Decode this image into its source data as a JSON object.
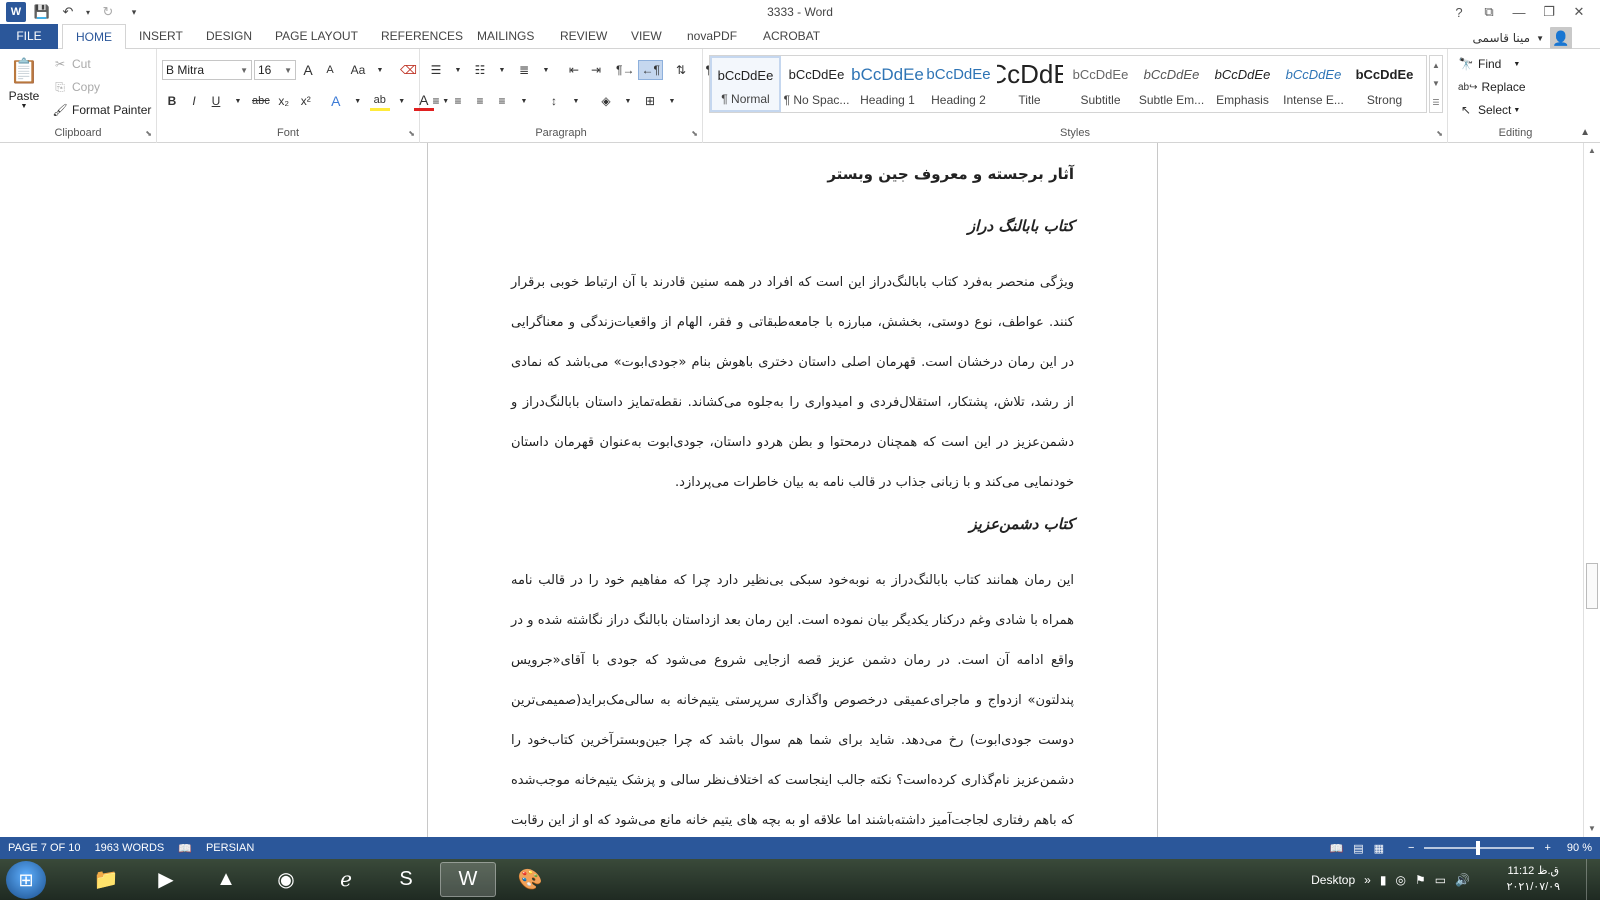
{
  "window": {
    "title": "3333 - Word"
  },
  "qat": {
    "undo_arrow": "▾",
    "customize": "▾"
  },
  "tabs": [
    {
      "label": "FILE"
    },
    {
      "label": "HOME"
    },
    {
      "label": "INSERT"
    },
    {
      "label": "DESIGN"
    },
    {
      "label": "PAGE LAYOUT"
    },
    {
      "label": "REFERENCES"
    },
    {
      "label": "MAILINGS"
    },
    {
      "label": "REVIEW"
    },
    {
      "label": "VIEW"
    },
    {
      "label": "novaPDF"
    },
    {
      "label": "ACROBAT"
    }
  ],
  "user": {
    "name": "مینا قاسمی"
  },
  "clipboard": {
    "paste": "Paste",
    "cut": "Cut",
    "copy": "Copy",
    "format_painter": "Format Painter",
    "label": "Clipboard"
  },
  "font": {
    "name": "B Mitra",
    "size": "16",
    "label": "Font",
    "grow": "A",
    "shrink": "A",
    "case": "Aa",
    "bold": "B",
    "italic": "I",
    "underline": "U",
    "strike": "abc",
    "sub": "x₂",
    "sup": "x²",
    "effects": "A",
    "highlight": "ab",
    "color": "A"
  },
  "paragraph": {
    "label": "Paragraph"
  },
  "styles": {
    "label": "Styles",
    "items": [
      {
        "sample": "bCcDdEe",
        "name": "¶ Normal"
      },
      {
        "sample": "bCcDdEe",
        "name": "¶ No Spac..."
      },
      {
        "sample": "bCcDdEe",
        "name": "Heading 1"
      },
      {
        "sample": "bCcDdEe",
        "name": "Heading 2"
      },
      {
        "sample": "bCcDdEe",
        "name": "Title"
      },
      {
        "sample": "bCcDdEe",
        "name": "Subtitle"
      },
      {
        "sample": "bCcDdEe",
        "name": "Subtle Em..."
      },
      {
        "sample": "bCcDdEe",
        "name": "Emphasis"
      },
      {
        "sample": "bCcDdEe",
        "name": "Intense E..."
      },
      {
        "sample": "bCcDdEe",
        "name": "Strong"
      }
    ]
  },
  "editing": {
    "find": "Find",
    "replace": "Replace",
    "select": "Select",
    "label": "Editing"
  },
  "document": {
    "heading_main": "آثار برجسته و معروف جین وبستر",
    "heading_1": "کتاب بابالنگ دراز",
    "para_1": "ویژگی منحصر به‌فرد کتاب بابالنگ‌دراز این است که افراد در همه سنین قادرند با آن ارتباط خوبی برقرار کنند. عواطف، نوع دوستی، بخشش، مبارزه با جامعه‌طبقاتی و فقر، الهام از واقعیات‌زندگی و معناگرایی در این رمان درخشان است. قهرمان اصلی داستان دختری باهوش بنام «جودی‌ابوت» می‌باشد که نمادی از رشد، تلاش، پشتکار، استقلال‌فردی و امیدواری را به‌جلوه می‌کشاند. نقطه‌تمایز داستان بابالنگ‌دراز و دشمن‌عزیز در این است که همچنان درمحتوا و بطن هردو داستان، جودی‌ابوت به‌عنوان قهرمان داستان خودنمایی می‌کند و با زبانی جذاب در قالب نامه به بیان خاطرات می‌پردازد.",
    "heading_2": "کتاب دشمن‌عزیز",
    "para_2": "این رمان همانند کتاب بابالنگ‌دراز به نوبه‌خود سبکی بی‌نظیر دارد چرا که مفاهیم خود را در قالب نامه همراه با شادی وغم درکنار یکدیگر بیان نموده است. این رمان بعد ازداستان بابالنگ دراز نگاشته شده و در واقع ادامه آن است. در رمان دشمن عزیز قصه ازجایی شروع می‌شود که جودی با آقای«جرویس پندلتون» ازدواج و ماجرای‌عمیقی درخصوص واگذاری سرپرستی یتیم‌خانه به سالی‌مک‌براید(صمیمی‌ترین دوست جودی‌ابوت) رخ می‌دهد. شاید برای شما هم سوال باشد که چرا جین‌وبستر‌آخرین کتاب‌خود را دشمن‌عزیز نام‌گذاری کرده‌است؟ نکته جالب اینجاست که اختلاف‌نظر سالی و پزشک یتیم‌خانه موجب‌شده که باهم رفتاری لجاجت‌آمیز داشته‌باشند اما علاقه او به بچه های یتیم خانه مانع می‌شود که او از این رقابت کوتاه بیاید."
  },
  "status": {
    "page": "PAGE 7 OF 10",
    "words": "1963 WORDS",
    "language": "PERSIAN",
    "zoom": "90 %",
    "zoom_minus": "−",
    "zoom_plus": "+"
  },
  "taskbar": {
    "desktop": "Desktop",
    "time": "11:12 ق.ظ",
    "date": "۲۰۲۱/۰۷/۰۹"
  },
  "colors": {
    "accent": "#2b579a"
  }
}
